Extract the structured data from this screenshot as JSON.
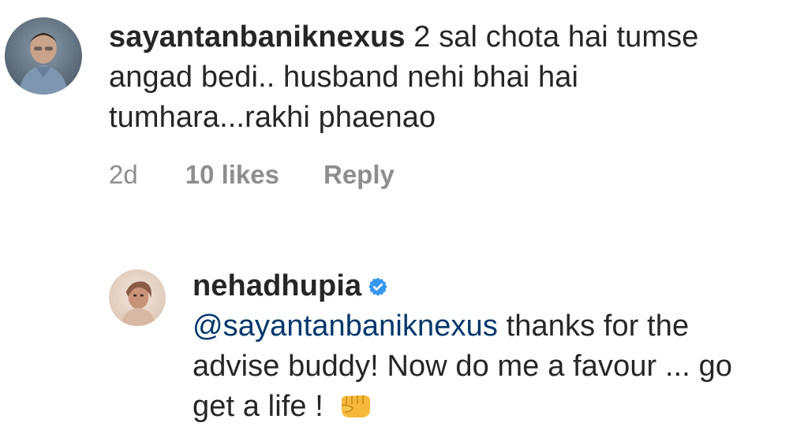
{
  "comments": [
    {
      "username": "sayantanbaniknexus",
      "text": "2 sal chota hai tumse angad bedi.. husband nehi bhai hai tumhara...rakhi phaenao",
      "time": "2d",
      "likes": "10 likes",
      "reply_label": "Reply",
      "avatar_icon": "user-avatar-icon"
    },
    {
      "username": "nehadhupia",
      "verified_icon": "verified-badge-icon",
      "mention": "@sayantanbaniknexus",
      "text": "thanks for the advise buddy! Now do me a favour ... go get a life !",
      "emoji": "fist-emoji-icon",
      "avatar_icon": "user-avatar-icon"
    }
  ],
  "colors": {
    "text": "#262626",
    "meta": "#8e8e8e",
    "mention": "#00376b",
    "verified": "#3897f0"
  }
}
